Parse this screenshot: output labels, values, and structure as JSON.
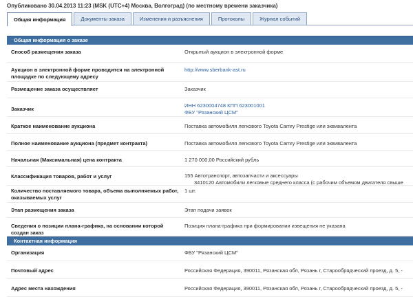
{
  "header": {
    "published": "Опубликовано 30.04.2013 11:23 (MSK (UTC+4) Москва, Волгоград) (по местному времени заказчика)"
  },
  "tabs": [
    {
      "label": "Общая информация",
      "active": true
    },
    {
      "label": "Документы заказа",
      "active": false
    },
    {
      "label": "Изменения и разъяснения",
      "active": false
    },
    {
      "label": "Протоколы",
      "active": false
    },
    {
      "label": "Журнал событий",
      "active": false
    }
  ],
  "general": {
    "title": "Общая информация о заказе",
    "rows": [
      {
        "label": "Способ размещения заказа",
        "value": "Открытый аукцион в электронной форме"
      },
      {
        "label": "Аукцион в электронной форме проводится на электронной площадке по следующему адресу",
        "value": "http://www.sberbank-ast.ru"
      },
      {
        "label": "Размещение заказа осуществляет",
        "value": "Заказчик"
      },
      {
        "label": "Заказчик",
        "value": "ИНН 6230004748 КПП 623001001",
        "value2": "ФБУ \"Рязанский ЦСМ\""
      },
      {
        "label": "Краткое наименование аукциона",
        "value": "Поставка автомобиля легкового Toyota Camry Prestige или эквивалента"
      },
      {
        "label": "Полное наименование аукциона (предмет контракта)",
        "value": "Поставка автомобиля легкового Toyota Camry Prestige или эквивалента"
      },
      {
        "label": "Начальная (Максимальная) цена контракта",
        "value": "1 270 000,00 Российский рубль"
      },
      {
        "label": "Классификация товаров, работ и услуг",
        "value": "155 Автотранспорт, автозапчасти и аксессуары",
        "value2": "3410120 Автомобили легковые среднего класса (с рабочим объемом двигателя свыше"
      },
      {
        "label": "Количество поставляемого товара, объема выполняемых работ, оказываемых услуг",
        "value": "1 шт."
      },
      {
        "label": "Этап размещения заказа",
        "value": "Этап подачи заявок"
      },
      {
        "label": "Сведения о позиции плана-графика, на основании которой создан заказ",
        "value": "Позиция плана-графика при формировании извещения не указана"
      }
    ]
  },
  "contact": {
    "title": "Контактная информация",
    "rows": [
      {
        "label": "Организация",
        "value": "ФБУ \"Рязанский ЦСМ\""
      },
      {
        "label": "Почтовый адрес",
        "value": "Российская Федерация, 390011, Рязанская обл, Рязань г, Старообрядческий проезд, д. 5, -"
      },
      {
        "label": "Адрес места нахождения",
        "value": "Российская Федерация, 390011, Рязанская обл, Рязань г, Старообрядческий проезд, д. 5, -"
      }
    ]
  }
}
